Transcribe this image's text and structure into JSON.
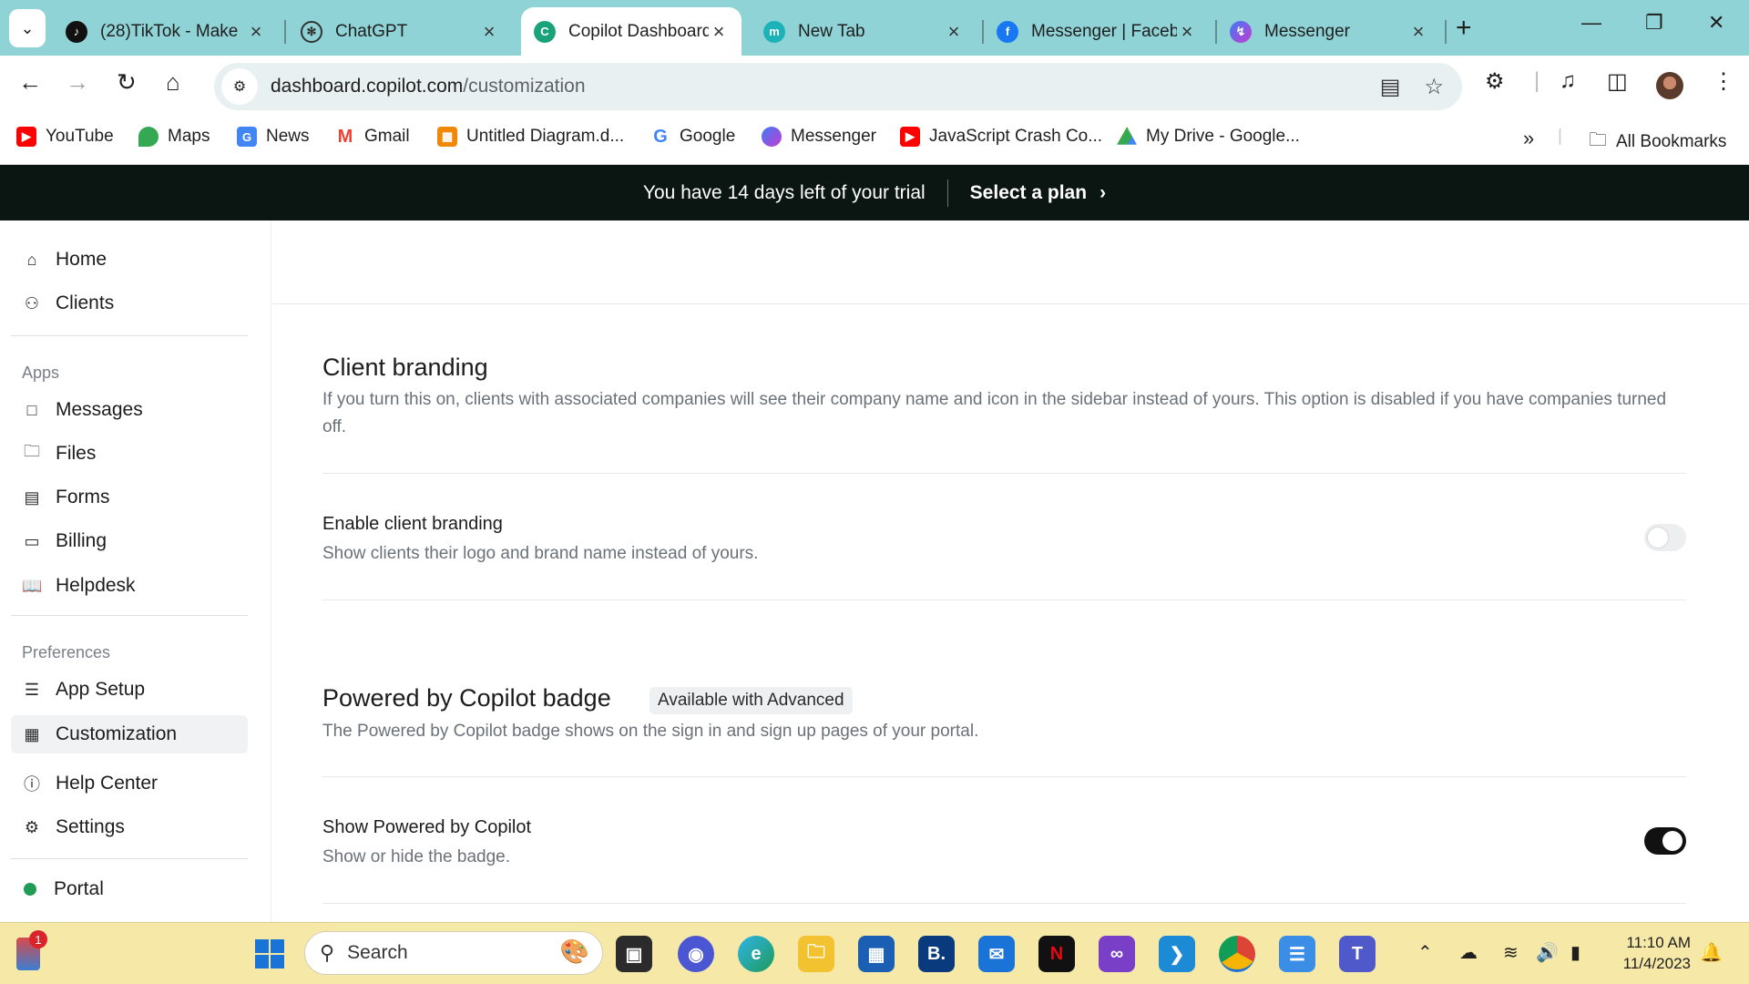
{
  "browser": {
    "tabs": [
      {
        "title": "(28)TikTok - Make"
      },
      {
        "title": "ChatGPT"
      },
      {
        "title": "Copilot Dashboard"
      },
      {
        "title": "New Tab"
      },
      {
        "title": "Messenger | Faceb"
      },
      {
        "title": "Messenger"
      }
    ],
    "url_host": "dashboard.copilot.com",
    "url_path": "/customization",
    "bookmarks": [
      {
        "label": "YouTube"
      },
      {
        "label": "Maps"
      },
      {
        "label": "News"
      },
      {
        "label": "Gmail"
      },
      {
        "label": "Untitled Diagram.d..."
      },
      {
        "label": "Google"
      },
      {
        "label": "Messenger"
      },
      {
        "label": "JavaScript Crash Co..."
      },
      {
        "label": "My Drive - Google..."
      }
    ],
    "all_bookmarks": "All Bookmarks"
  },
  "banner": {
    "trial_text": "You have 14 days left of your trial",
    "plan_link": "Select a plan"
  },
  "sidebar": {
    "top_items": [
      {
        "label": "Home",
        "icon": "home-icon"
      },
      {
        "label": "Clients",
        "icon": "users-icon"
      }
    ],
    "apps_heading": "Apps",
    "apps": [
      {
        "label": "Messages",
        "icon": "message-icon"
      },
      {
        "label": "Files",
        "icon": "folder-icon"
      },
      {
        "label": "Forms",
        "icon": "clipboard-icon"
      },
      {
        "label": "Billing",
        "icon": "card-icon"
      },
      {
        "label": "Helpdesk",
        "icon": "book-icon"
      }
    ],
    "prefs_heading": "Preferences",
    "prefs": [
      {
        "label": "App Setup",
        "icon": "sliders-icon"
      },
      {
        "label": "Customization",
        "icon": "grid-icon",
        "active": true
      }
    ],
    "bottom": [
      {
        "label": "Help Center",
        "icon": "help-icon"
      },
      {
        "label": "Settings",
        "icon": "gear-icon"
      }
    ],
    "portal": "Portal"
  },
  "main": {
    "client_branding": {
      "title": "Client branding",
      "description": "If you turn this on, clients with associated companies will see their company name and icon in the sidebar instead of yours. This option is disabled if you have companies turned off.",
      "toggle_label": "Enable client branding",
      "toggle_sub": "Show clients their logo and brand name instead of yours.",
      "toggle_on": false
    },
    "powered_badge": {
      "title": "Powered by Copilot badge",
      "badge": "Available with Advanced",
      "description": "The Powered by Copilot badge shows on the sign in and sign up pages of your portal.",
      "toggle_label": "Show Powered by Copilot",
      "toggle_sub": "Show or hide the badge.",
      "toggle_on": true
    }
  },
  "taskbar": {
    "search_placeholder": "Search",
    "time": "11:10 AM",
    "date": "11/4/2023",
    "weather_badge": "1"
  },
  "colors": {
    "tabstrip": "#8fd3d6",
    "banner": "#0b1512",
    "taskbar": "#f6e9a8",
    "toggle_on": "#111111"
  }
}
